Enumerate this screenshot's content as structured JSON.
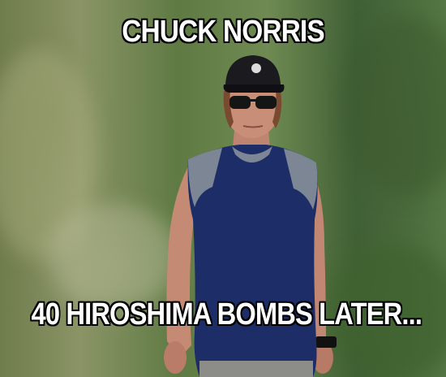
{
  "meme": {
    "top_text": "CHUCK NORRIS",
    "bottom_text": "40 HIROSHIMA BOMBS LATER..."
  },
  "colors": {
    "shirt_navy": "#1c2c66",
    "shirt_grey": "#7b8492",
    "skin": "#c98e78",
    "cap": "#1a1a1f",
    "foliage": "#5f7a43"
  }
}
